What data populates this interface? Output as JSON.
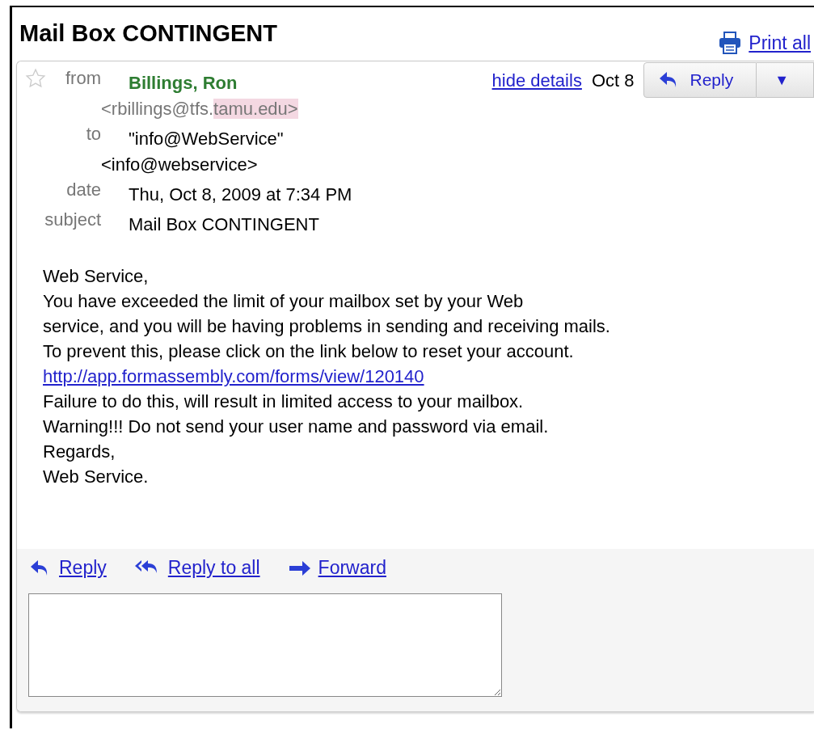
{
  "title": "Mail Box CONTINGENT",
  "print_all": "Print all",
  "message": {
    "starred": false,
    "from_label": "from",
    "sender_name": "Billings, Ron",
    "sender_email": [
      {
        "text": "<rbillings@tfs.",
        "highlighted": false
      },
      {
        "text": "tamu.edu>",
        "highlighted": true
      }
    ],
    "hide_details": "hide details",
    "date_short": "Oct 8",
    "reply_button": "Reply",
    "more_button": "▼",
    "to_label": "to",
    "to_name": "\"info@WebService\"",
    "to_email": "<info@webservice>",
    "date_label": "date",
    "date": "Thu, Oct 8, 2009 at 7:34 PM",
    "subject_label": "subject",
    "subject": "Mail Box CONTINGENT",
    "body": [
      {
        "kind": "text",
        "text": "Web Service,"
      },
      {
        "kind": "text",
        "text": "You have exceeded the limit of your mailbox set by your Web"
      },
      {
        "kind": "text",
        "text": "service, and you will be having problems in sending and receiving mails."
      },
      {
        "kind": "text",
        "text": "To prevent this, please click on the link below to reset your account."
      },
      {
        "kind": "link",
        "text": "http://app.formassembly.com/forms/view/120140"
      },
      {
        "kind": "text",
        "text": "Failure to do this, will result in limited access to your mailbox."
      },
      {
        "kind": "text",
        "text": "Warning!!! Do not send your user name and password via email."
      },
      {
        "kind": "text",
        "text": "Regards,"
      },
      {
        "kind": "text",
        "text": "Web Service."
      }
    ],
    "actions": [
      {
        "kind": "reply",
        "label": "Reply"
      },
      {
        "kind": "reply_all",
        "label": "Reply to all"
      },
      {
        "kind": "forward",
        "label": "Forward"
      }
    ]
  }
}
